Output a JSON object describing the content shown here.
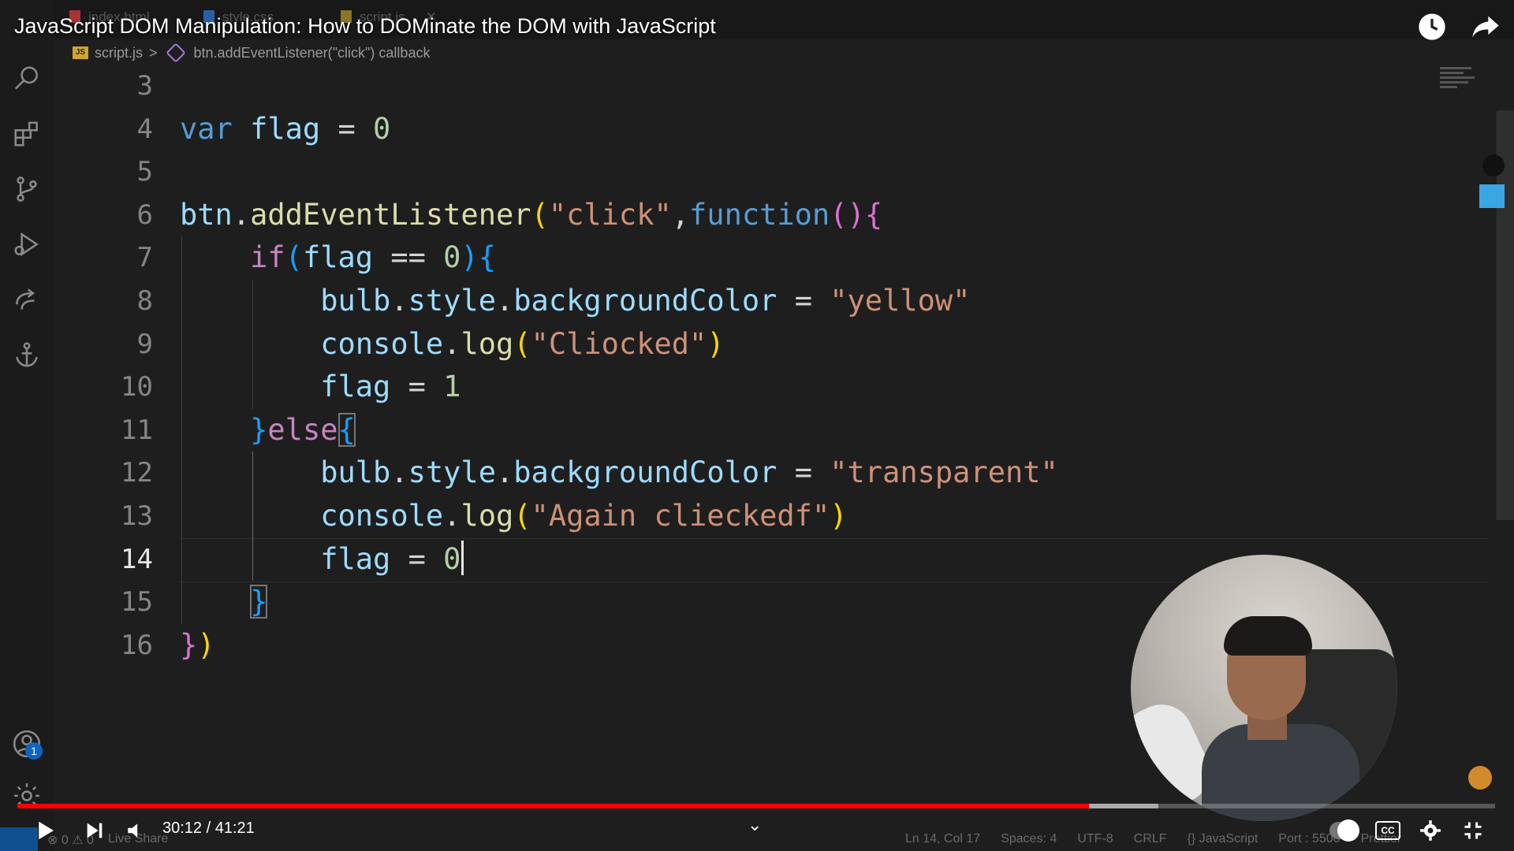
{
  "video": {
    "title": "JavaScript DOM Manipulation: How to DOMinate the DOM with JavaScript",
    "time_current": "30:12",
    "time_separator": " / ",
    "time_total": "41:21",
    "progress_played_fraction": 0.725,
    "progress_buffered_fraction": 0.772
  },
  "editor": {
    "tabs": [
      {
        "label": "index.html",
        "icon": "html-file-icon"
      },
      {
        "label": "style.css",
        "icon": "css-file-icon"
      },
      {
        "label": "script.js",
        "icon": "js-file-icon",
        "active": true
      }
    ],
    "breadcrumb": {
      "file": "script.js",
      "separator": ">",
      "symbol": "btn.addEventListener(\"click\") callback"
    },
    "active_line": 14,
    "lines": [
      {
        "n": "3",
        "tokens": []
      },
      {
        "n": "4",
        "tokens": [
          {
            "t": "var",
            "c": "kw"
          },
          {
            "t": " ",
            "c": "op"
          },
          {
            "t": "flag",
            "c": "var"
          },
          {
            "t": " = ",
            "c": "op"
          },
          {
            "t": "0",
            "c": "num"
          }
        ]
      },
      {
        "n": "5",
        "tokens": []
      },
      {
        "n": "6",
        "tokens": [
          {
            "t": "btn",
            "c": "var"
          },
          {
            "t": ".",
            "c": "op"
          },
          {
            "t": "addEventListener",
            "c": "fn"
          },
          {
            "t": "(",
            "c": "b1"
          },
          {
            "t": "\"click\"",
            "c": "str"
          },
          {
            "t": ",",
            "c": "op"
          },
          {
            "t": "function",
            "c": "kw"
          },
          {
            "t": "()",
            "c": "b2"
          },
          {
            "t": "{",
            "c": "b2"
          }
        ]
      },
      {
        "n": "7",
        "tokens": [
          {
            "t": "    ",
            "c": "op"
          },
          {
            "t": "if",
            "c": "ctl"
          },
          {
            "t": "(",
            "c": "b3"
          },
          {
            "t": "flag",
            "c": "var"
          },
          {
            "t": " == ",
            "c": "op"
          },
          {
            "t": "0",
            "c": "num"
          },
          {
            "t": ")",
            "c": "b3"
          },
          {
            "t": "{",
            "c": "b3"
          }
        ]
      },
      {
        "n": "8",
        "tokens": [
          {
            "t": "        ",
            "c": "op"
          },
          {
            "t": "bulb",
            "c": "var"
          },
          {
            "t": ".",
            "c": "op"
          },
          {
            "t": "style",
            "c": "var"
          },
          {
            "t": ".",
            "c": "op"
          },
          {
            "t": "backgroundColor",
            "c": "var"
          },
          {
            "t": " = ",
            "c": "op"
          },
          {
            "t": "\"yellow\"",
            "c": "str"
          }
        ]
      },
      {
        "n": "9",
        "tokens": [
          {
            "t": "        ",
            "c": "op"
          },
          {
            "t": "console",
            "c": "var"
          },
          {
            "t": ".",
            "c": "op"
          },
          {
            "t": "log",
            "c": "fn"
          },
          {
            "t": "(",
            "c": "b1"
          },
          {
            "t": "\"Cliocked\"",
            "c": "str"
          },
          {
            "t": ")",
            "c": "b1"
          }
        ]
      },
      {
        "n": "10",
        "tokens": [
          {
            "t": "        ",
            "c": "op"
          },
          {
            "t": "flag",
            "c": "var"
          },
          {
            "t": " = ",
            "c": "op"
          },
          {
            "t": "1",
            "c": "num"
          }
        ]
      },
      {
        "n": "11",
        "tokens": [
          {
            "t": "    ",
            "c": "op"
          },
          {
            "t": "}",
            "c": "b3"
          },
          {
            "t": "else",
            "c": "ctl"
          },
          {
            "t": "{",
            "c": "b3",
            "bm": true
          }
        ]
      },
      {
        "n": "12",
        "tokens": [
          {
            "t": "        ",
            "c": "op"
          },
          {
            "t": "bulb",
            "c": "var"
          },
          {
            "t": ".",
            "c": "op"
          },
          {
            "t": "style",
            "c": "var"
          },
          {
            "t": ".",
            "c": "op"
          },
          {
            "t": "backgroundColor",
            "c": "var"
          },
          {
            "t": " = ",
            "c": "op"
          },
          {
            "t": "\"transparent\"",
            "c": "str"
          }
        ]
      },
      {
        "n": "13",
        "tokens": [
          {
            "t": "        ",
            "c": "op"
          },
          {
            "t": "console",
            "c": "var"
          },
          {
            "t": ".",
            "c": "op"
          },
          {
            "t": "log",
            "c": "fn"
          },
          {
            "t": "(",
            "c": "b1"
          },
          {
            "t": "\"Again clieckedf\"",
            "c": "str"
          },
          {
            "t": ")",
            "c": "b1"
          }
        ]
      },
      {
        "n": "14",
        "tokens": [
          {
            "t": "        ",
            "c": "op"
          },
          {
            "t": "flag",
            "c": "var"
          },
          {
            "t": " = ",
            "c": "op"
          },
          {
            "t": "0",
            "c": "num"
          }
        ],
        "cursor": true
      },
      {
        "n": "15",
        "tokens": [
          {
            "t": "    ",
            "c": "op"
          },
          {
            "t": "}",
            "c": "b3",
            "bm": true
          }
        ]
      },
      {
        "n": "16",
        "tokens": [
          {
            "t": "}",
            "c": "b2"
          },
          {
            "t": ")",
            "c": "b1"
          }
        ]
      }
    ]
  },
  "activity_bar": {
    "icons": [
      "search-icon",
      "extensions-icon",
      "source-control-icon",
      "run-debug-icon",
      "live-share-icon",
      "anchor-icon",
      "account-icon",
      "settings-gear-icon"
    ],
    "account_badge": "1"
  },
  "status_bar": {
    "errors": "0",
    "warnings": "0",
    "live_share": "Live Share",
    "position": "Ln 14, Col 17",
    "spaces": "Spaces: 4",
    "encoding": "UTF-8",
    "eol": "CRLF",
    "language": "JavaScript",
    "port": "Port : 5500",
    "formatter": "Prettier"
  },
  "player_controls": {
    "cc_label": "CC"
  },
  "colors": {
    "progress_played": "#ff0000",
    "editor_bg": "#1e1e1e",
    "remote_indicator": "#0a66c2"
  }
}
